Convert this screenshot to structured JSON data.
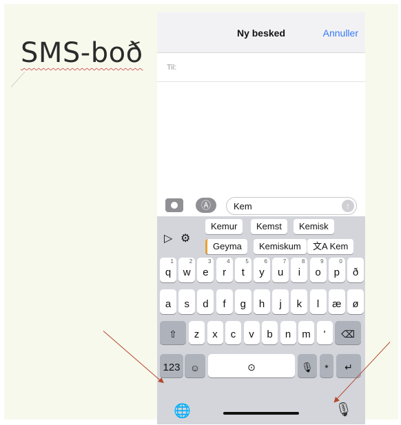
{
  "slide": {
    "title": "SMS-boð"
  },
  "phone": {
    "nav": {
      "title": "Ny besked",
      "cancel": "Annuller"
    },
    "to_label": "Til:",
    "compose": {
      "text": "Kem",
      "send_icon": "arrow-up-icon"
    },
    "predictions": {
      "row1": [
        "Kemur",
        "Kemst",
        "Kemisk"
      ],
      "row2": [
        "Geyma",
        "Kemiskum",
        "文A Kem"
      ]
    },
    "keyboard": {
      "row1": [
        {
          "k": "q",
          "n": "1"
        },
        {
          "k": "w",
          "n": "2"
        },
        {
          "k": "e",
          "n": "3"
        },
        {
          "k": "r",
          "n": "4"
        },
        {
          "k": "t",
          "n": "5"
        },
        {
          "k": "y",
          "n": "6"
        },
        {
          "k": "u",
          "n": "7"
        },
        {
          "k": "i",
          "n": "8"
        },
        {
          "k": "o",
          "n": "9"
        },
        {
          "k": "p",
          "n": "0"
        },
        {
          "k": "ð",
          "n": ""
        }
      ],
      "row2": [
        "a",
        "s",
        "d",
        "f",
        "g",
        "h",
        "j",
        "k",
        "l",
        "æ",
        "ø"
      ],
      "row3": [
        "z",
        "x",
        "c",
        "v",
        "b",
        "n",
        "m",
        "'"
      ],
      "numbers_key": "123",
      "icons": [
        "shift-icon",
        "delete-icon",
        "emoji-icon",
        "space-icon",
        "mic-icon",
        "return-icon",
        "globe-icon",
        "dictation-icon"
      ]
    }
  }
}
